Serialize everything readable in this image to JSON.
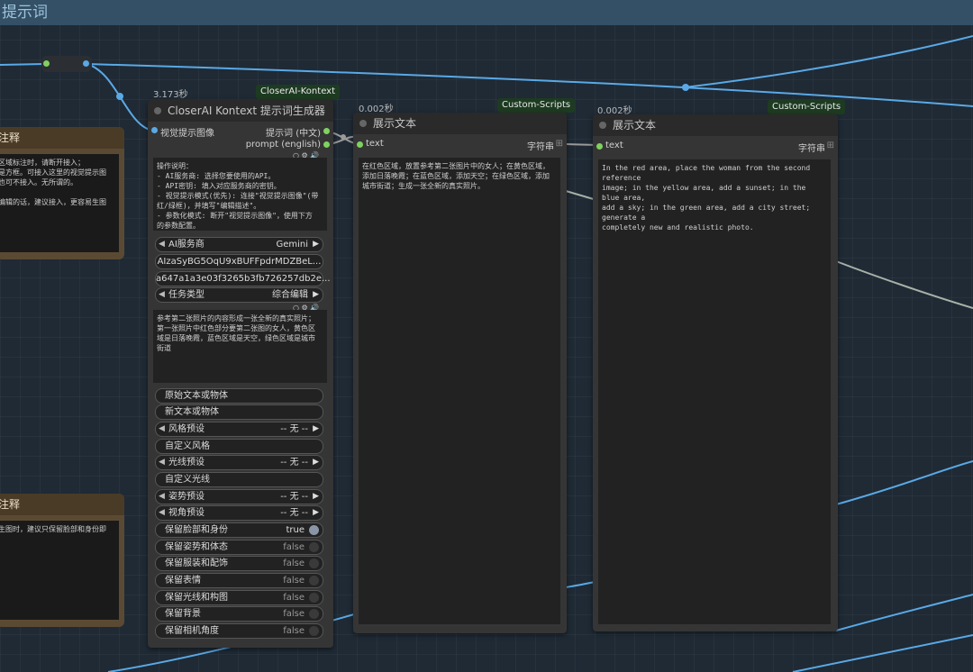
{
  "group": {
    "title": "提示词"
  },
  "notes": [
    {
      "title": "注释",
      "lines": [
        "区域标注时，请断开接入；",
        "是方框。可接入这里的视觉提示图",
        "也可不接入。无所谓的。",
        "",
        "编辑的话，建议接入，更容易生图"
      ]
    },
    {
      "title": "注释",
      "lines": [
        "生图时，建议只保留脸部和身份即"
      ]
    }
  ],
  "node_prompt": {
    "timing": "3.173秒",
    "badge": "CloserAI-Kontext",
    "title": "CloserAI Kontext 提示词生成器",
    "input_label": "视觉提示图像",
    "output_cn": "提示词 (中文)",
    "output_en": "prompt (english)",
    "instructions": [
      "操作说明：",
      "- AI服务商: 选择您要使用的API。",
      "- API密钥: 填入对应服务商的密钥。",
      "- 视觉提示模式(优先): 连接\"视觉提示图像\"(带",
      "红/绿框)，并填写\"编辑描述\"。",
      "- 参数化模式: 断开\"视觉提示图像\"，使用下方",
      "的参数配置。"
    ],
    "service_label": "AI服务商",
    "service_value": "Gemini",
    "api_key": "AIzaSyBG5OqU9xBUFFpdrMDZBeL...",
    "secret": "a647a1a3e03f3265b3fb726257db2e...",
    "task_label": "任务类型",
    "task_value": "综合编辑",
    "description": [
      "参考第二张照片的内容形成一张全新的真实照片；",
      "第一张照片中红色部分要第二张图的女人，黄色区",
      "域是日落晚霞，蓝色区域是天空，绿色区域是城市",
      "街道"
    ],
    "orig_text": "原始文本或物体",
    "new_text": "新文本或物体",
    "style_label": "风格预设",
    "style_value": "-- 无 --",
    "custom_style": "自定义风格",
    "light_label": "光线预设",
    "light_value": "-- 无 --",
    "custom_light": "自定义光线",
    "pose_label": "姿势预设",
    "pose_value": "-- 无 --",
    "angle_label": "视角预设",
    "angle_value": "-- 无 --",
    "toggles": [
      {
        "label": "保留脸部和身份",
        "value": "true"
      },
      {
        "label": "保留姿势和体态",
        "value": "false"
      },
      {
        "label": "保留服装和配饰",
        "value": "false"
      },
      {
        "label": "保留表情",
        "value": "false"
      },
      {
        "label": "保留光线和构图",
        "value": "false"
      },
      {
        "label": "保留背景",
        "value": "false"
      },
      {
        "label": "保留相机角度",
        "value": "false"
      }
    ]
  },
  "node_show_cn": {
    "timing": "0.002秒",
    "badge": "Custom-Scripts",
    "title": "展示文本",
    "input_label": "text",
    "output_label": "字符串",
    "content": [
      "在红色区域，放置参考第二张图片中的女人；在黄色区域，",
      "添加日落晚霞；在蓝色区域，添加天空；在绿色区域，添加",
      "城市街道；生成一张全新的真实照片。"
    ]
  },
  "node_show_en": {
    "timing": "0.002秒",
    "badge": "Custom-Scripts",
    "title": "展示文本",
    "input_label": "text",
    "output_label": "字符串",
    "content": [
      "In the red area, place the woman from the second reference",
      "image; in the yellow area, add a sunset; in the blue area,",
      "add a sky; in the green area, add a city street; generate a",
      "completely new and realistic photo."
    ]
  },
  "colors": {
    "accent_green": "#7fd25f",
    "link_blue": "#5aa9e6",
    "badge_bg": "#1d3b21"
  }
}
